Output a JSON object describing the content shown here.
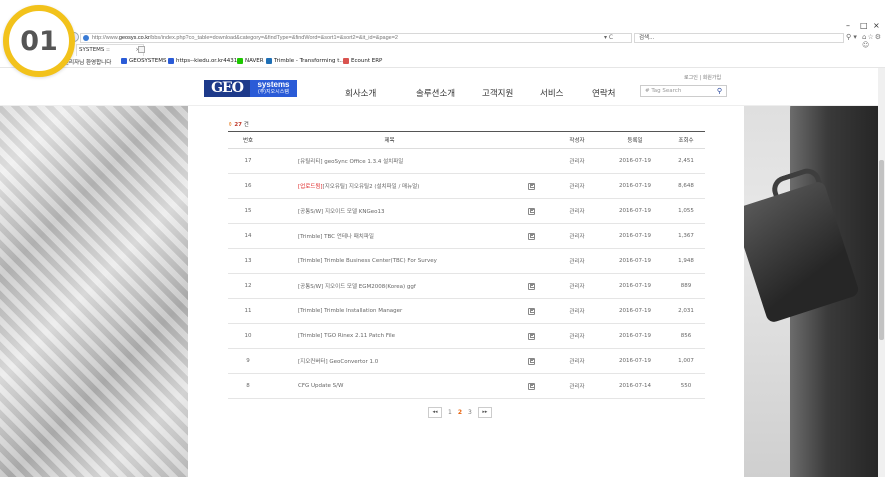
{
  "browser": {
    "url_prefix": "http://www.",
    "url_domain": "geosys.co.kr",
    "url_rest": "/bbs/index.php?co_table=download&category=&findType=&findWord=&sort1=&sort2=&it_id=&page=2",
    "addr_actions": "▾ C",
    "search_placeholder": "검색...",
    "tab_title": "SYSTEMS ::",
    "tab_close": "×",
    "favorites": [
      {
        "label": "관리자님 환영합니다",
        "color": "#e1a32a"
      },
      {
        "label": "GEOSYSTEMS",
        "color": "#2a5bd7"
      },
      {
        "label": "https--kiedu.or.kr4431-",
        "color": "#2a5bd7"
      },
      {
        "label": "NAVER",
        "color": "#1ec800"
      },
      {
        "label": "Trimble - Transforming t...",
        "color": "#1f6fb5"
      },
      {
        "label": "Ecount ERP",
        "color": "#d9534f"
      }
    ],
    "toolbar_icons": "⌂☆⚙☺",
    "win_min": "–",
    "win_max": "□",
    "win_close": "×",
    "search_icon": "⚲ ▾"
  },
  "site": {
    "logo_geo": "GEO",
    "logo_systems": "systems",
    "logo_korean": "(주)지오시스템",
    "nav": [
      "회사소개",
      "솔루션소개",
      "고객지원",
      "서비스",
      "연락처"
    ],
    "util_login": "로그인",
    "util_sep": "|",
    "util_join": "회원가입",
    "tag_search_placeholder": "# Tag Search",
    "search_icon": "search-icon"
  },
  "board": {
    "count_icon": "⚱",
    "count_value": "27",
    "count_unit": "건",
    "columns": [
      "번호",
      "제목",
      "작성자",
      "등록일",
      "조회수"
    ],
    "rows": [
      {
        "no": "17",
        "badge": "",
        "title": "[유틸리티] geoSync Office 1.3.4 설치파일",
        "file": false,
        "author": "관리자",
        "date": "2016-07-19",
        "views": "2,451"
      },
      {
        "no": "16",
        "badge": "[업로드됨]",
        "title": "[지오유틸] 지오유틸2 (설치파일 / 매뉴얼)",
        "file": true,
        "author": "관리자",
        "date": "2016-07-19",
        "views": "8,648"
      },
      {
        "no": "15",
        "badge": "",
        "title": "[공통S/W] 지오이드 모델 KNGeo13",
        "file": true,
        "author": "관리자",
        "date": "2016-07-19",
        "views": "1,055"
      },
      {
        "no": "14",
        "badge": "",
        "title": "[Trimble] TBC 언테나 패치파일",
        "file": true,
        "author": "관리자",
        "date": "2016-07-19",
        "views": "1,367"
      },
      {
        "no": "13",
        "badge": "",
        "title": "[Trimble] Trimble Business Center(TBC) For Survey",
        "file": false,
        "author": "관리자",
        "date": "2016-07-19",
        "views": "1,948"
      },
      {
        "no": "12",
        "badge": "",
        "title": "[공통S/W] 지오이드 모델 EGM2008(Korea) ggf",
        "file": true,
        "author": "관리자",
        "date": "2016-07-19",
        "views": "889"
      },
      {
        "no": "11",
        "badge": "",
        "title": "[Trimble] Trimble Installation Manager",
        "file": true,
        "author": "관리자",
        "date": "2016-07-19",
        "views": "2,031"
      },
      {
        "no": "10",
        "badge": "",
        "title": "[Trimble] TGO Rinex 2.11 Patch File",
        "file": true,
        "author": "관리자",
        "date": "2016-07-19",
        "views": "856"
      },
      {
        "no": "9",
        "badge": "",
        "title": "[지오컨버터] GeoConvertor 1.0",
        "file": true,
        "author": "관리자",
        "date": "2016-07-19",
        "views": "1,007"
      },
      {
        "no": "8",
        "badge": "",
        "title": "CFG Update S/W",
        "file": true,
        "author": "관리자",
        "date": "2016-07-14",
        "views": "550"
      }
    ],
    "pager": {
      "prev": "◂◂",
      "pages": [
        "1",
        "2",
        "3"
      ],
      "current": "2",
      "next": "▸▸"
    }
  },
  "overlay": {
    "step": "01",
    "badge_color": "#f2c21b"
  }
}
